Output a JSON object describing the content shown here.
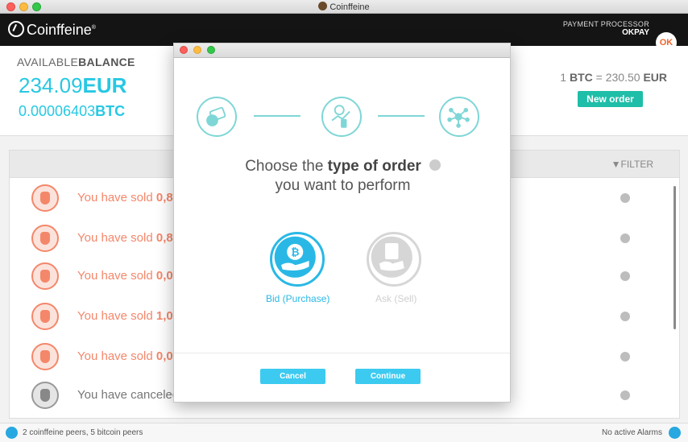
{
  "window": {
    "title": "Coinffeine"
  },
  "header": {
    "brand": "Coinffeine",
    "brand_mark": "®",
    "payment_processor_label": "PAYMENT PROCESSOR",
    "payment_processor_name": "OKPAY",
    "okpay_badge": "OK"
  },
  "balance": {
    "label_prefix": "AVAILABLE",
    "label_bold": "BALANCE",
    "eur_amount": "234.09",
    "eur_unit": "EUR",
    "btc_amount": "0.00006403",
    "btc_unit": "BTC",
    "rate_prefix": "1",
    "rate_btc": "BTC",
    "rate_mid": "= 230.50",
    "rate_eur": "EUR",
    "new_order_label": "New order"
  },
  "list": {
    "filter_label": "FILTER",
    "rows": [
      {
        "text": "You have sold ",
        "bold": "0,8",
        "status": "sold"
      },
      {
        "text": "You have sold ",
        "bold": "0,8",
        "status": "sold"
      },
      {
        "text": "You have sold ",
        "bold": "0,0",
        "status": "sold"
      },
      {
        "text": "You have sold ",
        "bold": "1,0",
        "status": "sold"
      },
      {
        "text": "You have sold ",
        "bold": "0,0",
        "status": "sold"
      },
      {
        "text": "You have canceled",
        "bold": "",
        "status": "canceled"
      }
    ]
  },
  "status": {
    "peers": "2 coinffeine peers, 5 bitcoin peers",
    "alarms": "No active Alarms"
  },
  "dialog": {
    "question_line1_prefix": "Choose the ",
    "question_line1_bold": "type of order",
    "question_line2": "you want to perform",
    "bid_label": "Bid (Purchase)",
    "ask_label": "Ask (Sell)",
    "cancel_label": "Cancel",
    "continue_label": "Continue"
  },
  "colors": {
    "accent": "#27c8e3",
    "sold": "#f4876a",
    "new_order": "#1ebea8",
    "step": "#7fd6d6"
  }
}
